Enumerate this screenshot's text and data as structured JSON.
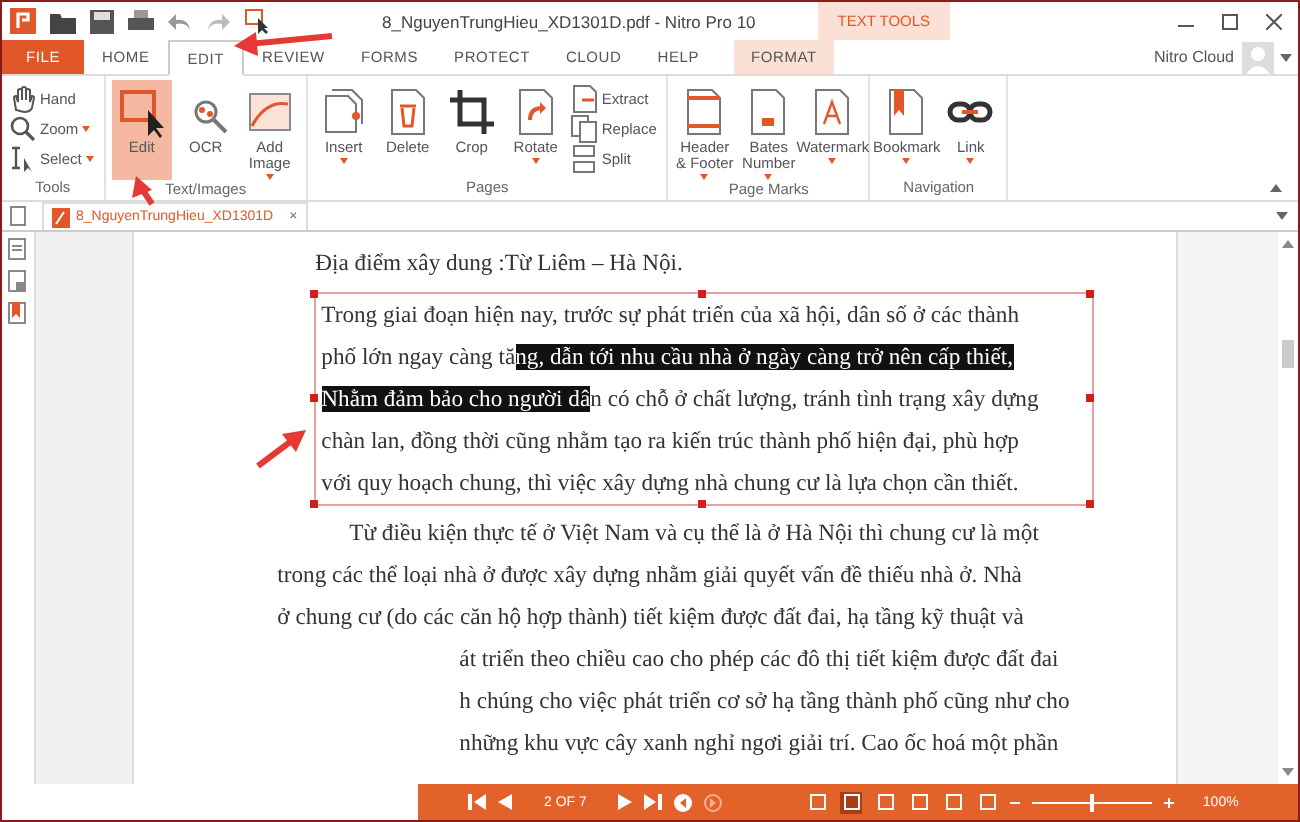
{
  "title_bar": {
    "title": "8_NguyenTrungHieu_XD1301D.pdf - Nitro Pro 10",
    "context_group": "TEXT TOOLS"
  },
  "tabs": [
    {
      "label": "FILE",
      "kind": "file",
      "selected": false
    },
    {
      "label": "HOME",
      "kind": "normal",
      "selected": false
    },
    {
      "label": "EDIT",
      "kind": "normal",
      "selected": true
    },
    {
      "label": "REVIEW",
      "kind": "normal",
      "selected": false
    },
    {
      "label": "FORMS",
      "kind": "normal",
      "selected": false
    },
    {
      "label": "PROTECT",
      "kind": "normal",
      "selected": false
    },
    {
      "label": "CLOUD",
      "kind": "normal",
      "selected": false
    },
    {
      "label": "HELP",
      "kind": "normal",
      "selected": false
    },
    {
      "label": "FORMAT",
      "kind": "context",
      "selected": false
    }
  ],
  "account": "Nitro Cloud",
  "ribbon_groups": [
    {
      "label": "Tools",
      "items": [
        {
          "label": "Hand",
          "kind": "small",
          "selected": false,
          "dropdown": false
        },
        {
          "label": "Zoom",
          "kind": "small",
          "selected": false,
          "dropdown": true
        },
        {
          "label": "Select",
          "kind": "small",
          "selected": false,
          "dropdown": true
        }
      ]
    },
    {
      "label": "Text/Images",
      "items": [
        {
          "label": "Edit",
          "kind": "large",
          "selected": true,
          "dropdown": false
        },
        {
          "label": "OCR",
          "kind": "large",
          "selected": false,
          "dropdown": false
        },
        {
          "label": "Add Image",
          "kind": "large",
          "selected": false,
          "dropdown": true
        }
      ]
    },
    {
      "label": "Pages",
      "items": [
        {
          "label": "Insert",
          "kind": "large",
          "selected": false,
          "dropdown": true
        },
        {
          "label": "Delete",
          "kind": "large",
          "selected": false,
          "dropdown": false
        },
        {
          "label": "Crop",
          "kind": "large",
          "selected": false,
          "dropdown": false
        },
        {
          "label": "Rotate",
          "kind": "large",
          "selected": false,
          "dropdown": true
        },
        {
          "label": "Extract",
          "kind": "small",
          "selected": false,
          "dropdown": false
        },
        {
          "label": "Replace",
          "kind": "small",
          "selected": false,
          "dropdown": false
        },
        {
          "label": "Split",
          "kind": "small",
          "selected": false,
          "dropdown": false
        }
      ]
    },
    {
      "label": "Page Marks",
      "items": [
        {
          "label": "Header & Footer",
          "kind": "large",
          "selected": false,
          "dropdown": true
        },
        {
          "label": "Bates Number",
          "kind": "large",
          "selected": false,
          "dropdown": true
        },
        {
          "label": "Watermark",
          "kind": "large",
          "selected": false,
          "dropdown": true
        }
      ]
    },
    {
      "label": "Navigation",
      "items": [
        {
          "label": "Bookmark",
          "kind": "large",
          "selected": false,
          "dropdown": true
        },
        {
          "label": "Link",
          "kind": "large",
          "selected": false,
          "dropdown": true
        }
      ]
    }
  ],
  "document_tab": {
    "label": "8_NguyenTrungHieu_XD1301D",
    "close": "×"
  },
  "document": {
    "heading": "Địa điểm xây dung :Từ Liêm – Hà Nội.",
    "box_lines": [
      [
        {
          "text": "Trong giai đoạn hiện nay,  trước sự phát triển của xã hội, dân số ở các thành",
          "selected": false
        }
      ],
      [
        {
          "text": "phố lớn ngay càng tă",
          "selected": false
        },
        {
          "text": "ng, dẫn tới nhu cầu nhà ở ngày càng trở nên cấp thiết,",
          "selected": true
        }
      ],
      [
        {
          "text": "Nhằm đảm bảo cho người dâ",
          "selected": true
        },
        {
          "text": "n có chỗ ở chất lượng, tránh tình trạng xây dựng",
          "selected": false
        }
      ],
      [
        {
          "text": "chàn lan, đồng thời cũng nhằm tạo ra kiến trúc thành phố hiện đại, phù hợp",
          "selected": false
        }
      ],
      [
        {
          "text": "với quy hoạch chung, thì việc xây dựng nhà chung cư là lựa chọn cần thiết.",
          "selected": false
        }
      ]
    ],
    "lines": [
      {
        "text": "Từ điều kiện thực tế ở Việt Nam và cụ thể là ở Hà Nội thì chung cư là một",
        "kind": "indent"
      },
      {
        "text": "trong các thể loại nhà ở được xây dựng nhằm giải quyết vấn đề thiếu nhà ở. Nhà",
        "kind": "plain"
      },
      {
        "text": "ở chung cư (do các căn hộ hợp thành) tiết kiệm được đất đai, hạ tầng kỹ thuật và",
        "kind": "plain"
      },
      {
        "text": "át triển theo chiều cao cho phép các đô thị tiết kiệm được đất đai",
        "kind": "cut"
      },
      {
        "text": "h chúng cho việc phát triển cơ sở hạ tầng thành phố cũng như cho",
        "kind": "cut"
      },
      {
        "text": "những khu vực cây xanh nghỉ ngơi giải trí. Cao ốc hoá một phần",
        "kind": "cut"
      }
    ]
  },
  "status_bar": {
    "page": "2 OF 7",
    "view_modes": [
      {
        "selected": false
      },
      {
        "selected": true
      },
      {
        "selected": false
      },
      {
        "selected": false
      },
      {
        "selected": false
      },
      {
        "selected": false
      }
    ],
    "zoom_slider": {
      "level": 0.5
    },
    "zoom": "100%"
  }
}
